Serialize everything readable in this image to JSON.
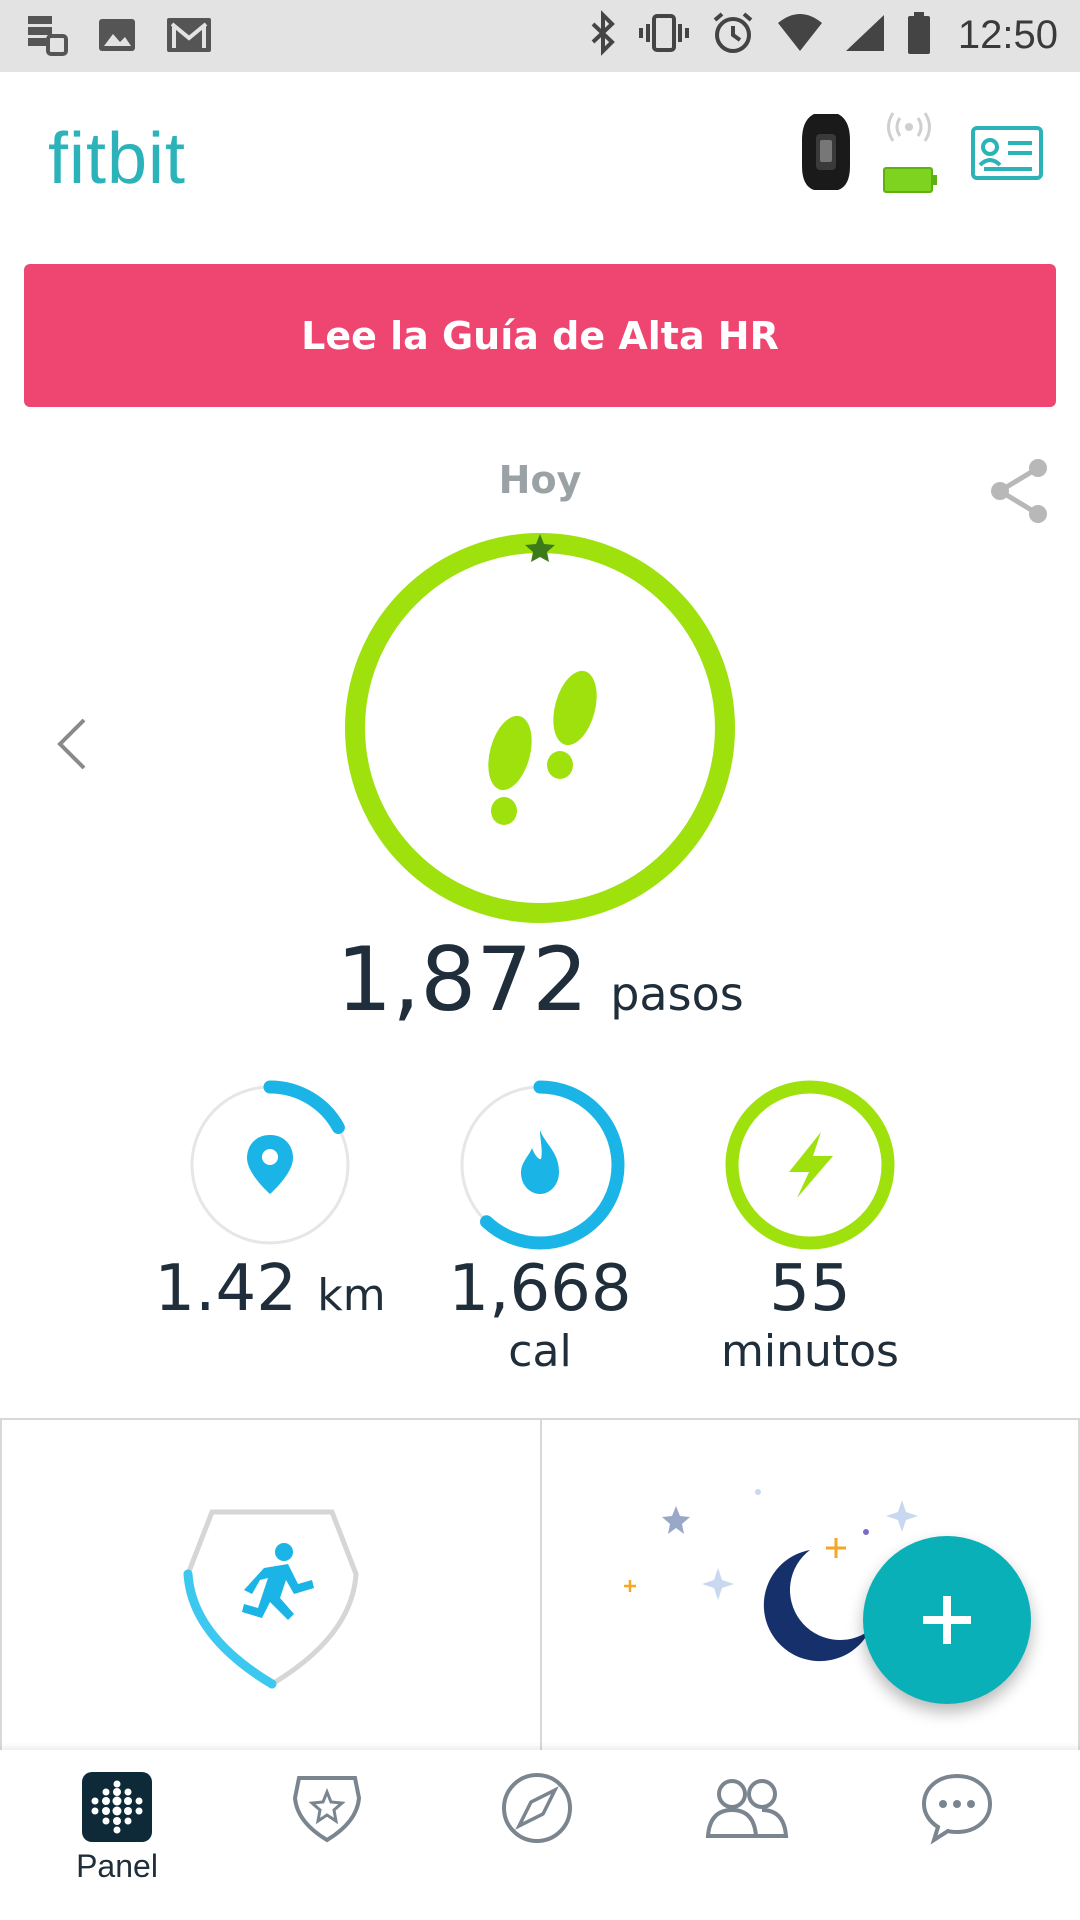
{
  "status_bar": {
    "time": "12:50",
    "icons": [
      "notification-stack-icon",
      "image-icon",
      "gmail-icon",
      "bluetooth-icon",
      "vibrate-icon",
      "alarm-icon",
      "wifi-icon",
      "signal-icon",
      "battery-icon"
    ]
  },
  "header": {
    "logo": "fitbit",
    "device": "tracker-band-icon",
    "device_battery_color": "#7ed321",
    "account_icon": "account-card-icon"
  },
  "banner": {
    "label": "Lee la Guía de Alta HR",
    "color": "#ef4571"
  },
  "today": {
    "label": "Hoy",
    "steps": {
      "value": "1,872",
      "unit": "pasos",
      "goal_progress": 1.0,
      "color": "#9fe10c"
    },
    "stats": [
      {
        "id": "distance",
        "value": "1.42",
        "unit": "km",
        "progress": 0.17,
        "color": "#1ab4e6",
        "icon": "location-pin-icon"
      },
      {
        "id": "calories",
        "value": "1,668",
        "unit": "cal",
        "progress": 0.62,
        "color": "#1ab4e6",
        "icon": "flame-icon"
      },
      {
        "id": "active",
        "value": "55",
        "unit": "minutos",
        "progress": 1.0,
        "color": "#9fe10c",
        "icon": "lightning-icon"
      }
    ]
  },
  "tiles": {
    "left": {
      "icon": "running-badge-icon",
      "progress": 0.3
    },
    "right": {
      "icon": "sleep-moon-icon"
    }
  },
  "fab": {
    "label": "+"
  },
  "nav": [
    {
      "id": "panel",
      "label": "Panel",
      "icon": "fitbit-dots-icon",
      "active": true
    },
    {
      "id": "challenges",
      "label": "",
      "icon": "star-shield-icon",
      "active": false
    },
    {
      "id": "discover",
      "label": "",
      "icon": "compass-icon",
      "active": false
    },
    {
      "id": "community",
      "label": "",
      "icon": "friends-icon",
      "active": false
    },
    {
      "id": "messages",
      "label": "",
      "icon": "chat-bubble-icon",
      "active": false
    }
  ]
}
